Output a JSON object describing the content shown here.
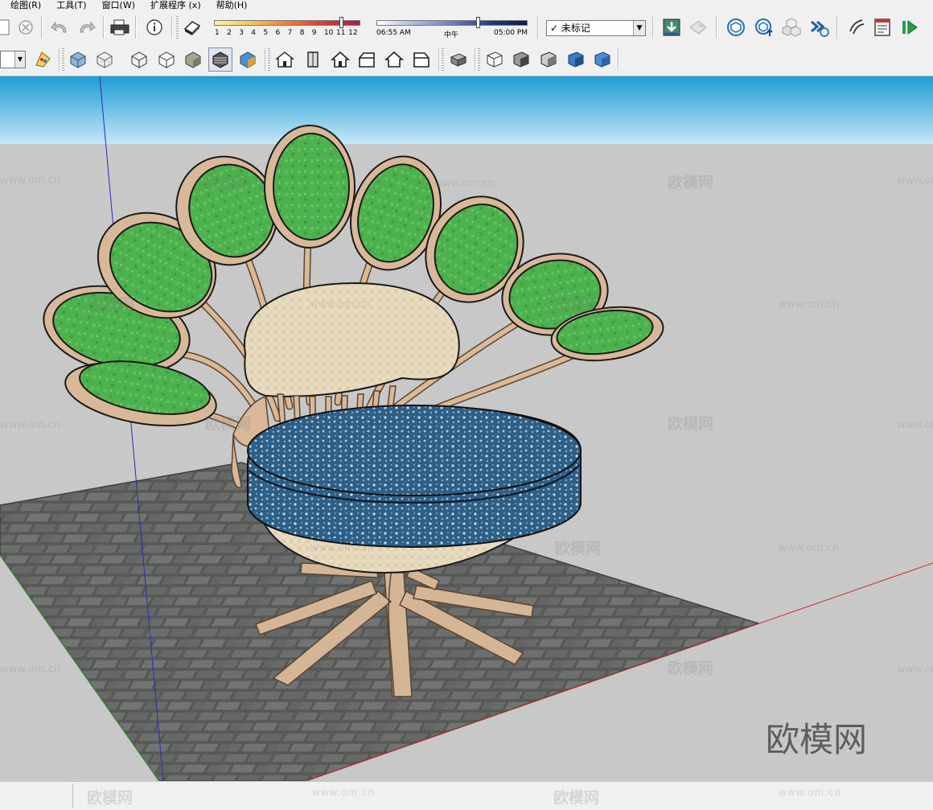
{
  "menu": [
    "绘图(R)",
    "工具(T)",
    "窗口(W)",
    "扩展程序 (x)",
    "帮助(H)"
  ],
  "shadow": {
    "months": [
      "1",
      "2",
      "3",
      "4",
      "5",
      "6",
      "7",
      "8",
      "9",
      "10",
      "11",
      "12"
    ],
    "month_value": 11,
    "time_start": "06:55 AM",
    "time_mid": "中午",
    "time_end": "05:00 PM",
    "time_value": 0.66
  },
  "layer": {
    "selected": "✓ 未标记"
  },
  "watermark": {
    "cn": "欧模网",
    "url": "www.om.cn",
    "big": "欧模网"
  },
  "colors": {
    "sky_top": "#1f9dd6",
    "sky_bottom": "#c4e7f6",
    "ground": "#c8c8c8",
    "floor": "#5f6260",
    "seat": "#2e5f86",
    "pads": "#4db24d",
    "back": "#e9dcc0",
    "wood": "#d8b899"
  }
}
